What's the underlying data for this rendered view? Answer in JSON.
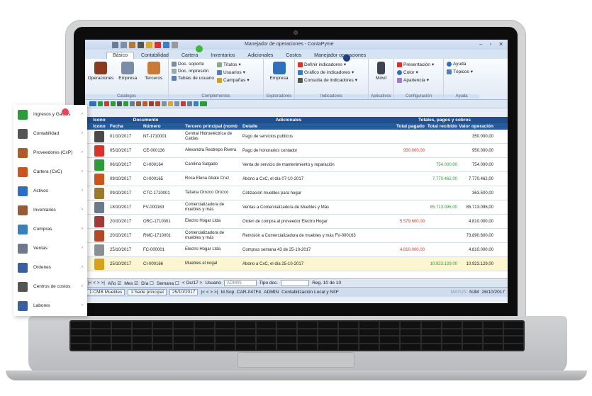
{
  "app": {
    "title": "Manejador de operaciones - ContaPyme"
  },
  "tabs": [
    "Básico",
    "Contabilidad",
    "Cartera",
    "Inventarios",
    "Adicionales",
    "Costos",
    "Manejador operaciones"
  ],
  "ribbon": {
    "catalogos": {
      "caption": "Catálogos",
      "operaciones": "Operaciones",
      "empresa": "Empresa",
      "terceros": "Terceros"
    },
    "complementos": {
      "caption": "Complementos",
      "doc_soporte": "Doc. soporte",
      "doc_impresion": "Doc. impresión",
      "tablas_usuario": "Tablas de usuario",
      "titulos": "Títulos",
      "usuarios": "Usuarios",
      "campanas": "Campañas"
    },
    "exploradores": {
      "caption": "Exploradores",
      "empresa": "Empresa"
    },
    "indicadores": {
      "caption": "Indicadores",
      "definir": "Definir indicadores",
      "grafico": "Gráfico de indicadores",
      "consulta": "Consulta de indicadores"
    },
    "aplicativos": {
      "caption": "Aplicativos",
      "movil": "Móvil"
    },
    "configuracion": {
      "caption": "Configuración",
      "presentacion": "Presentación",
      "color": "Color",
      "apariencia": "Apariencia"
    },
    "ayuda": {
      "caption": "Ayuda",
      "ayuda": "Ayuda",
      "topicos": "Tópicos"
    }
  },
  "grid": {
    "group_headers": {
      "icono": "Icono",
      "documento": "Documento",
      "adicionales": "Adicionales",
      "totales": "Totales, pagos y cobros"
    },
    "columns": {
      "icono": "Icono",
      "fecha": "Fecha",
      "numero": "Número",
      "tercero": "Tercero principal (nomb",
      "detalle": "Detalle",
      "total_pagado": "Total pagado",
      "total_recibido": "Total recibido",
      "valor": "Valor operación"
    },
    "rows": [
      {
        "fecha": "01/10/2017",
        "numero": "NT-1710001",
        "tercero": "Central Hidroeléctrica de Caldas",
        "detalle": "Pago de servicios publicos",
        "pagado": "",
        "recibido": "",
        "valor": "350.000,00",
        "icon": "balance-icon",
        "color": "#4a4a4a"
      },
      {
        "fecha": "05/10/2017",
        "numero": "CE-000136",
        "tercero": "Alexandra Restrepo Rivera",
        "detalle": "Pago de honorarios contador",
        "pagado": "950.000,00",
        "recibido": "",
        "valor": "950.000,00",
        "icon": "dollar-red-icon",
        "color": "#d9342b"
      },
      {
        "fecha": "06/10/2017",
        "numero": "CI-000164",
        "tercero": "Carolina Salgado",
        "detalle": "Venta de servicio de mantenimiento y reparación",
        "pagado": "",
        "recibido": "754.000,00",
        "valor": "754.000,00",
        "icon": "dollar-green-icon",
        "color": "#2e9a3a"
      },
      {
        "fecha": "09/10/2017",
        "numero": "CI-000165",
        "tercero": "Rosa Elena Abate Cruz",
        "detalle": "Abono a CxC, el día 07-10-2017",
        "pagado": "",
        "recibido": "7.770.462,00",
        "valor": "7.770.462,00",
        "icon": "wallet-icon",
        "color": "#c9561f"
      },
      {
        "fecha": "09/10/2017",
        "numero": "CTC-1710001",
        "tercero": "Tatiana Orozco Orozco",
        "detalle": "Cotización muebles para hogar",
        "pagado": "",
        "recibido": "",
        "valor": "363.500,00",
        "icon": "quote-icon",
        "color": "#9a7b2d"
      },
      {
        "fecha": "18/10/2017",
        "numero": "FV-000163",
        "tercero": "Comercializadora de muebles y más",
        "detalle": "Ventas a Comercializadora de Muebles y Más",
        "pagado": "",
        "recibido": "85.713.096,00",
        "valor": "85.713.096,00",
        "icon": "invoice-icon",
        "color": "#6d7a8a"
      },
      {
        "fecha": "20/10/2017",
        "numero": "ORC-1710001",
        "tercero": "Electro Hogar Ltda",
        "detalle": "Orden de compra al proveedor Electro Hogar",
        "pagado": "5.579.600,00",
        "recibido": "",
        "valor": "4.810.000,00",
        "icon": "order-icon",
        "color": "#a33a3a"
      },
      {
        "fecha": "20/10/2017",
        "numero": "RMC-1710001",
        "tercero": "Comercializadora de muebles y más",
        "detalle": "Remisión a Comercializadora de muebles y más FV-000163",
        "pagado": "",
        "recibido": "",
        "valor": "73.890.600,00",
        "icon": "truck-icon",
        "color": "#b24a28"
      },
      {
        "fecha": "25/10/2017",
        "numero": "FC-000001",
        "tercero": "Electro Hogar Ltda",
        "detalle": "Compras semana 43 de 25-10-2017",
        "pagado": "4.810.000,00",
        "recibido": "",
        "valor": "4.810.000,00",
        "icon": "cart-icon",
        "color": "#8a8f96"
      },
      {
        "fecha": "25/10/2017",
        "numero": "CI-000166",
        "tercero": "Muebles el nogal",
        "detalle": "Abono a CxC, el día 25-10-2017",
        "pagado": "",
        "recibido": "10.923.129,00",
        "valor": "10.923.129,00",
        "icon": "wallet-icon",
        "color": "#d6a11d"
      }
    ]
  },
  "filter": {
    "ano": "Año",
    "mes": "Mes",
    "dia": "Día",
    "semana": "Semana",
    "periodo": "Oc/17",
    "usuario": "Usuario",
    "usuario_value": "ADMIN",
    "tipo": "Tipo doc.",
    "reg": "Reg. 10 de 10"
  },
  "status": {
    "empresa": "1:CMB Muebles",
    "sede": "1:Sede principal",
    "fecha": "25/10/2017",
    "id": "Id.Sop. CAR-047F4",
    "user": "ADMIN",
    "mode": "Contabilización Local y NIIF",
    "mayus": "MAYUS",
    "njm": "NJM",
    "date2": "26/10/2017"
  },
  "sidebar": [
    {
      "label": "Ingresos y Gastos",
      "icon": "dollar-icon",
      "color": "#2e9a3a"
    },
    {
      "label": "Contabilidad",
      "icon": "balance-icon",
      "color": "#555"
    },
    {
      "label": "Proveedores (CxP)",
      "icon": "people-icon",
      "color": "#b05a2a"
    },
    {
      "label": "Cartera (CxC)",
      "icon": "wallet-icon",
      "color": "#c9561f"
    },
    {
      "label": "Activos",
      "icon": "gear-icon",
      "color": "#2f6fbf"
    },
    {
      "label": "Inventarios",
      "icon": "box-icon",
      "color": "#9a5a3a"
    },
    {
      "label": "Compras",
      "icon": "cart-icon",
      "color": "#3a7fbf"
    },
    {
      "label": "Ventas",
      "icon": "invoice-icon",
      "color": "#6d7a8a"
    },
    {
      "label": "Ordenes",
      "icon": "order-icon",
      "color": "#3a5fa0"
    },
    {
      "label": "Centros de costos",
      "icon": "building-icon",
      "color": "#555"
    },
    {
      "label": "Labores",
      "icon": "task-icon",
      "color": "#3a5fa0"
    }
  ]
}
